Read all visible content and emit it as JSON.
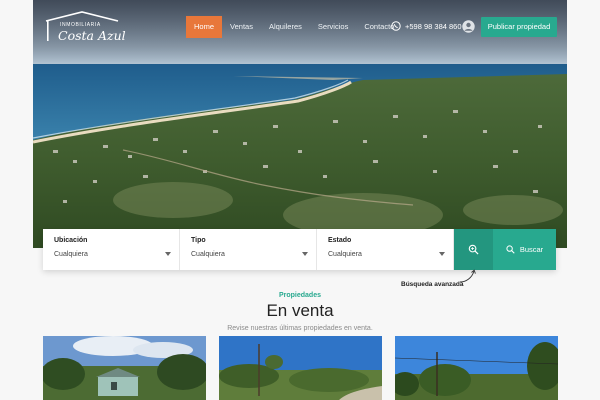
{
  "brand": {
    "top_text": "INMOBILIARIA",
    "name": "Costa Azul"
  },
  "nav": {
    "items": [
      {
        "label": "Home",
        "active": true
      },
      {
        "label": "Ventas",
        "active": false
      },
      {
        "label": "Alquileres",
        "active": false
      },
      {
        "label": "Servicios",
        "active": false
      },
      {
        "label": "Contacto",
        "active": false
      }
    ],
    "phone": "+598 98 384 860",
    "phone_icon": "whatsapp-icon",
    "user_icon": "user-icon",
    "publish_label": "Publicar propiedad"
  },
  "search": {
    "fields": [
      {
        "label": "Ubicación",
        "value": "Cualquiera"
      },
      {
        "label": "Tipo",
        "value": "Cualquiera"
      },
      {
        "label": "Estado",
        "value": "Cualquiera"
      }
    ],
    "advanced_icon": "zoom-icon",
    "button_label": "Buscar",
    "advanced_link": "Búsqueda avanzada"
  },
  "section": {
    "eyebrow": "Propiedades",
    "title": "En venta",
    "subtitle": "Revise nuestras últimas propiedades en venta."
  },
  "colors": {
    "accent": "#28a98f",
    "active_nav": "#e8773a"
  }
}
